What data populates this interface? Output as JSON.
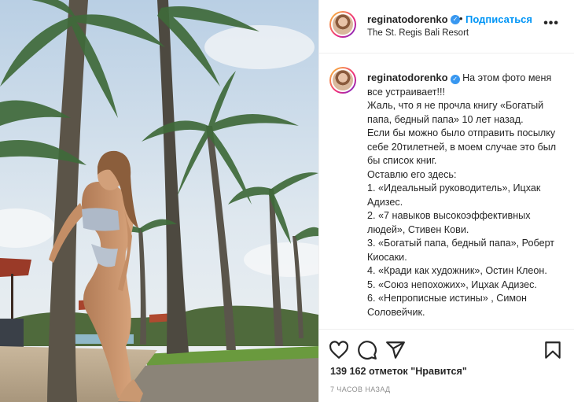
{
  "post": {
    "username": "reginatodorenko",
    "verified_mark": "✓",
    "separator": "•",
    "follow_label": "Подписаться",
    "location": "The St. Regis Bali Resort",
    "more_label": "•••",
    "caption": {
      "username": "reginatodorenko",
      "text": "На этом фото меня все устраивает!!!\nЖаль, что я не прочла книгу «Богатый папа, бедный папа» 10 лет назад.\nЕсли бы можно было отправить посылку себе 20тилетней, в моем случае это был бы список книг.\nОставлю его здесь:\n1. «Идеальный руководитель», Ицхак Адизес.\n2. «7 навыков высокоэффективных людей», Стивен Кови.\n3. «Богатый папа, бедный папа», Роберт Киосаки.\n4. «Кради как художник», Остин Клеон.\n5. «Союз непохожих», Ицхак Адизес.\n6. «Непрописные истины» , Симон Соловейчик."
    },
    "icons": {
      "like": "heart-icon",
      "comment": "comment-icon",
      "share": "share-icon",
      "save": "bookmark-icon"
    },
    "likes": "139 162 отметок \"Нравится\"",
    "timestamp": "7 ЧАСОВ НАЗАД",
    "colors": {
      "link_blue": "#0095f6",
      "verified_blue": "#3897f0",
      "text": "#262626",
      "muted": "#8e8e8e",
      "divider": "#efefef"
    }
  }
}
